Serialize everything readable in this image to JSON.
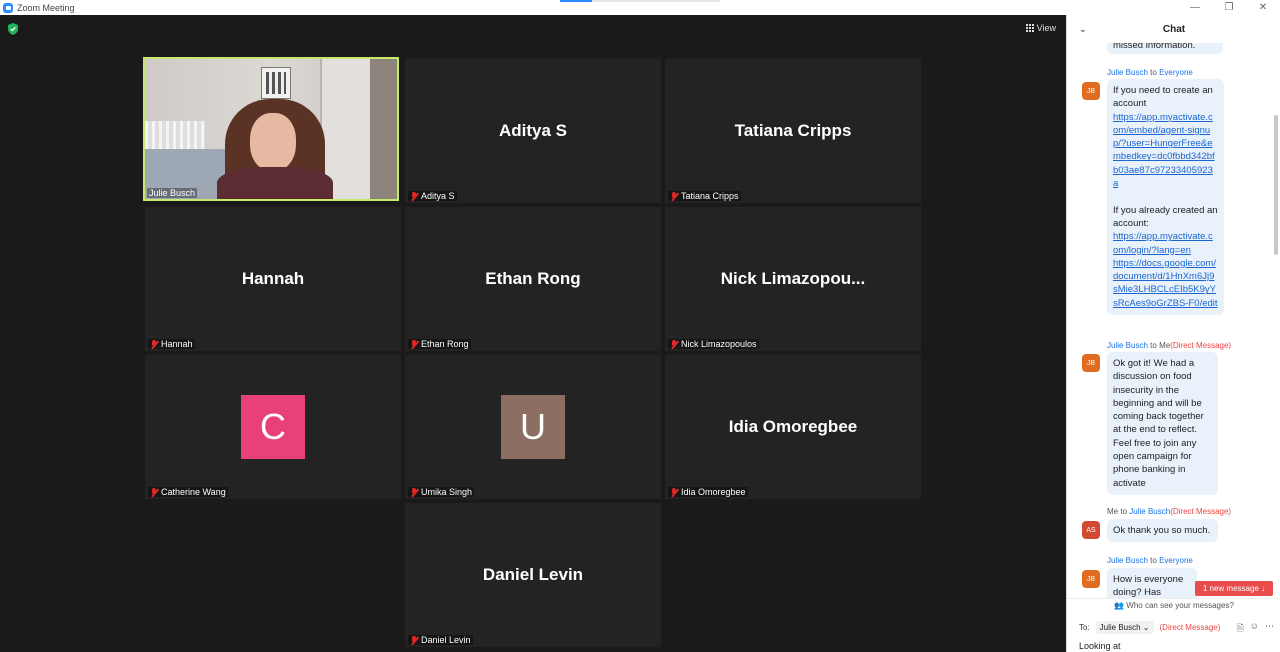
{
  "window": {
    "title": "Zoom Meeting",
    "minimize": "—",
    "restore": "❐",
    "close": "✕"
  },
  "toolbar": {
    "view_label": "View"
  },
  "participants": [
    {
      "name": "Julie Busch",
      "label": "Julie Busch",
      "type": "video",
      "active": true
    },
    {
      "name": "Aditya S",
      "label": "Aditya S",
      "type": "name"
    },
    {
      "name": "Tatiana Cripps",
      "label": "Tatiana Cripps",
      "type": "name"
    },
    {
      "name": "Hannah",
      "label": "Hannah",
      "type": "name"
    },
    {
      "name": "Ethan Rong",
      "label": "Ethan Rong",
      "type": "name"
    },
    {
      "name": "Nick  Limazopou...",
      "label": "Nick Limazopoulos",
      "type": "name"
    },
    {
      "avatar_letter": "C",
      "avatar_color": "#e8407a",
      "label": "Catherine Wang",
      "type": "avatar"
    },
    {
      "avatar_letter": "U",
      "avatar_color": "#8d6e63",
      "label": "Umika Singh",
      "type": "avatar"
    },
    {
      "name": "Idia Omoregbee",
      "label": "Idia Omoregbee",
      "type": "name"
    },
    {
      "name": "Daniel Levin",
      "label": "Daniel Levin",
      "type": "name"
    }
  ],
  "chat": {
    "title": "Chat",
    "collapse_icon": "⌄",
    "prev_fragment": "missed information.",
    "messages": [
      {
        "from": "Julie Busch",
        "to_word": "to",
        "to": "Everyone",
        "dm": "",
        "avatar": "JB",
        "parts": [
          {
            "t": "text",
            "v": "If you need to create an account"
          },
          {
            "t": "link",
            "v": "https://app.myactivate.com/embed/agent-signup/?user=HungerFree&embedkey=dc0fbbd342bfb03ae87c97233405923a"
          },
          {
            "t": "text",
            "v": " "
          },
          {
            "t": "text",
            "v": "If you already created an account:"
          },
          {
            "t": "link",
            "v": "https://app.myactivate.com/login/?lang=en"
          },
          {
            "t": "link",
            "v": "https://docs.google.com/document/d/1HnXm6Jj9sMie3LHBCLcEIb5K9yYsRcAes9oGrZBS-F0/edit"
          }
        ]
      },
      {
        "from": "Julie Busch",
        "to_word": "to",
        "to": "Me",
        "dm": "(Direct Message)",
        "avatar": "JB",
        "parts": [
          {
            "t": "text",
            "v": "Ok got it! We had a discussion on food insecurity in the beginning and will be coming back together at the end to reflect. Feel free to join any open campaign for phone banking in activate"
          }
        ]
      },
      {
        "from": "Me",
        "to_word": "to",
        "to": "Julie Busch",
        "dm": "(Direct Message)",
        "avatar": "AS",
        "parts": [
          {
            "t": "text",
            "v": "Ok thank you so much."
          }
        ]
      },
      {
        "from": "Julie Busch",
        "to_word": "to",
        "to": "Everyone",
        "dm": "",
        "avatar": "JB",
        "parts": [
          {
            "t": "text",
            "v": "How is everyone doing? Has anyone"
          }
        ]
      }
    ],
    "new_message": "1 new message ↓",
    "who_can_see": "Who can see your messages?",
    "to_label": "To:",
    "to_recipient": "Julie Busch ⌄",
    "to_dm": "(Direct Message)",
    "input_value": "Looking at"
  }
}
